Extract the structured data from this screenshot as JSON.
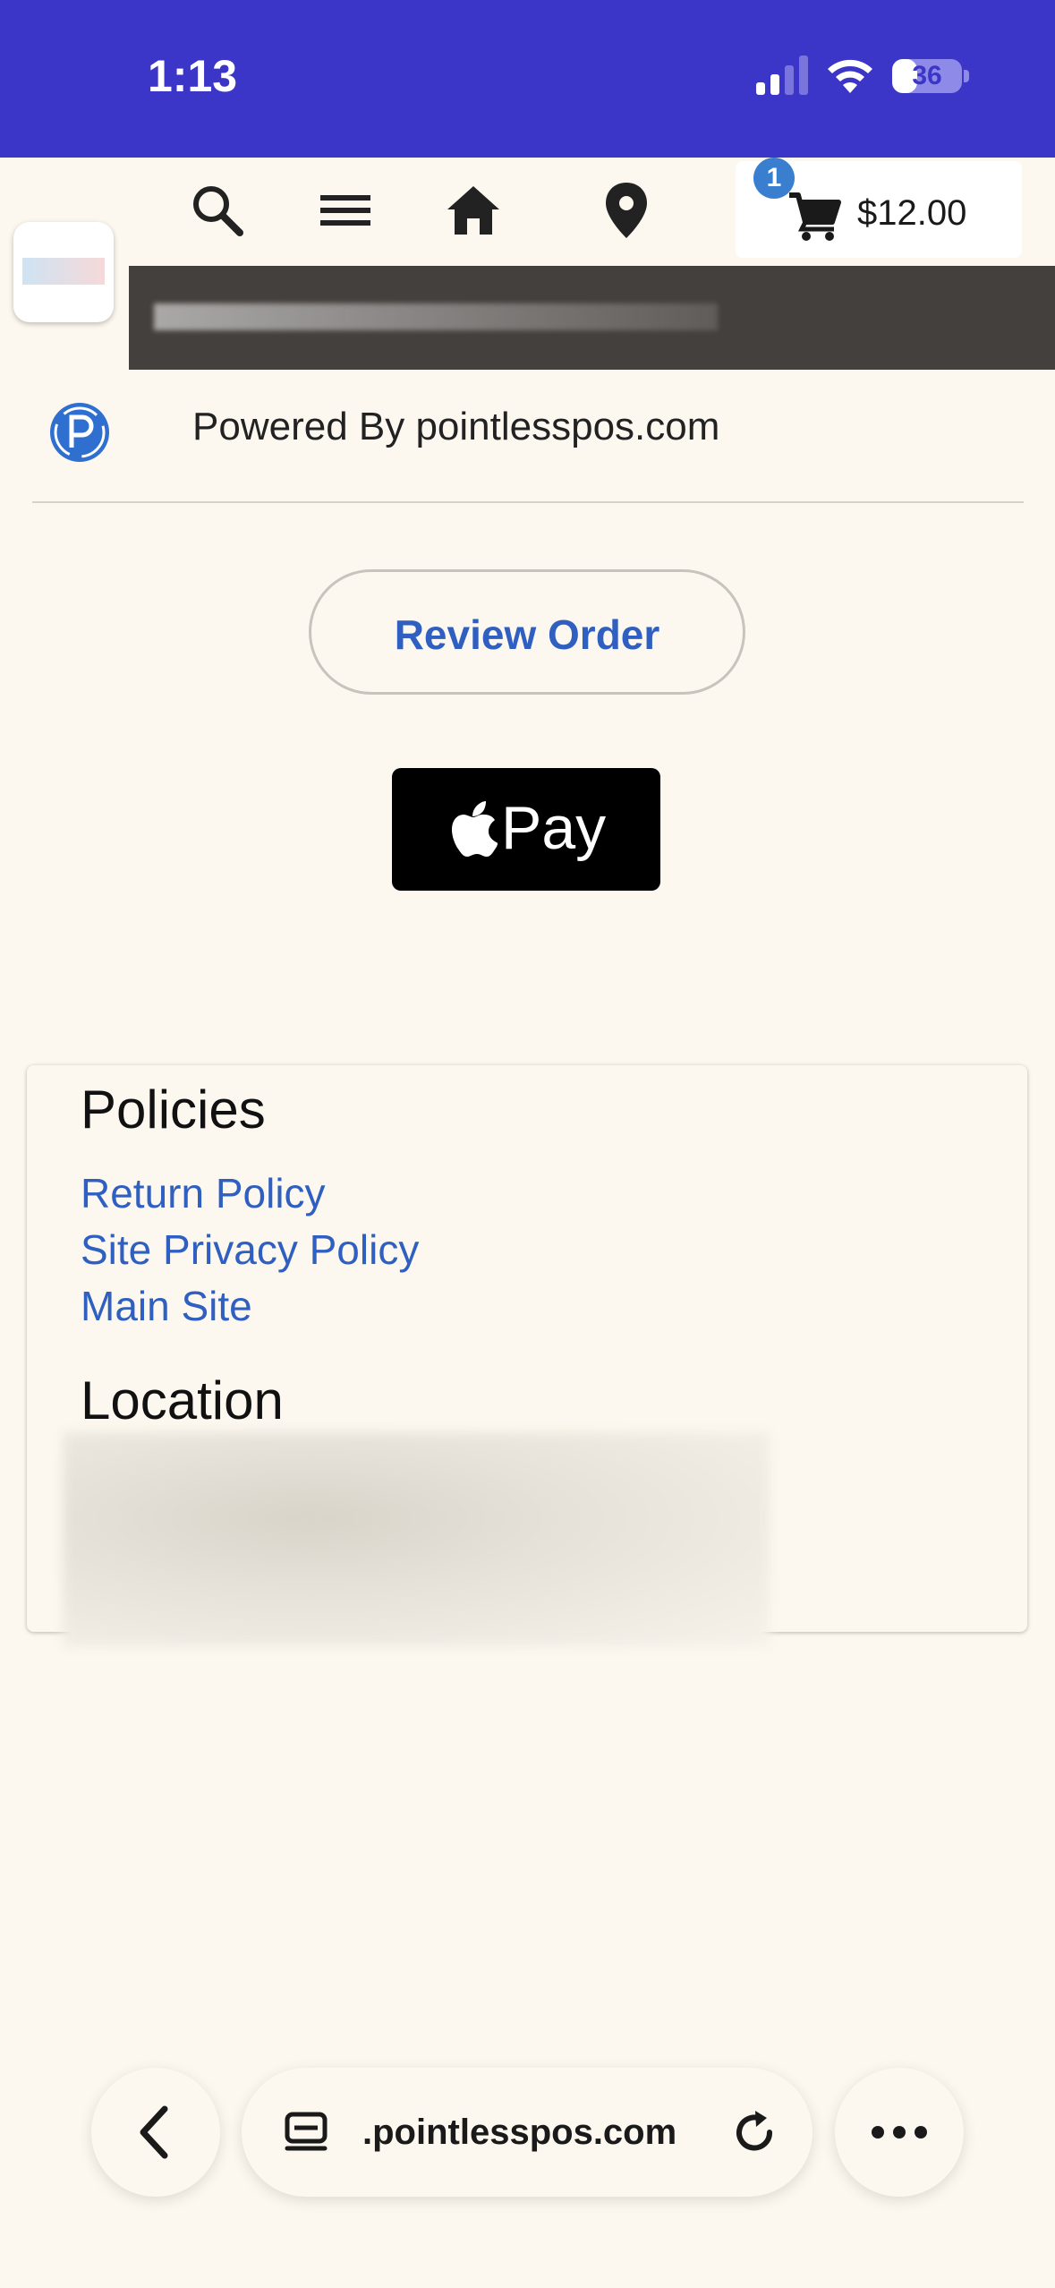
{
  "status_bar": {
    "time": "1:13",
    "battery": "36",
    "battery_level": 0.36
  },
  "nav": {
    "icons": [
      "search-icon",
      "menu-icon",
      "home-icon",
      "location-pin-icon",
      "cart-icon"
    ],
    "cart_count": "1",
    "cart_total": "$12.00"
  },
  "powered_by": {
    "text": "Powered By pointlesspos.com"
  },
  "actions": {
    "review_order": "Review Order",
    "apple_pay": "Pay"
  },
  "policies": {
    "title": "Policies",
    "links": [
      "Return Policy",
      "Site Privacy Policy",
      "Main Site"
    ]
  },
  "location": {
    "title": "Location"
  },
  "browser": {
    "url": ".pointlesspos.com"
  },
  "colors": {
    "status_bar": "#3b35c8",
    "background": "#fcf8ef",
    "link_blue": "#2f5fc0",
    "badge_blue": "#3a7fcf"
  }
}
